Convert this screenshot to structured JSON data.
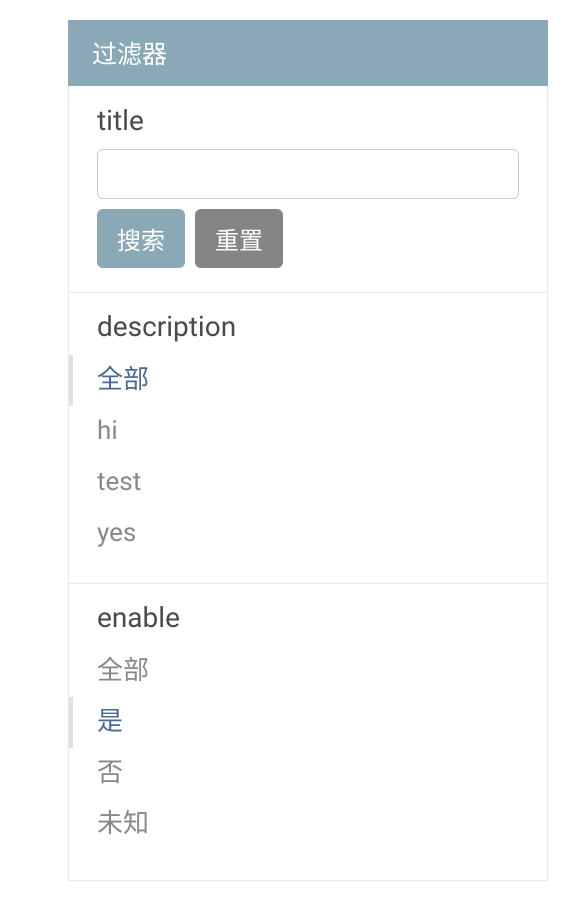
{
  "header": {
    "title": "过滤器"
  },
  "sections": {
    "title": {
      "label": "title",
      "input_value": "",
      "search_label": "搜索",
      "reset_label": "重置"
    },
    "description": {
      "label": "description",
      "options": [
        {
          "label": "全部",
          "active": true
        },
        {
          "label": "hi",
          "active": false
        },
        {
          "label": "test",
          "active": false
        },
        {
          "label": "yes",
          "active": false
        }
      ]
    },
    "enable": {
      "label": "enable",
      "options": [
        {
          "label": "全部",
          "active": false
        },
        {
          "label": "是",
          "active": true
        },
        {
          "label": "否",
          "active": false
        },
        {
          "label": "未知",
          "active": false
        }
      ]
    }
  }
}
